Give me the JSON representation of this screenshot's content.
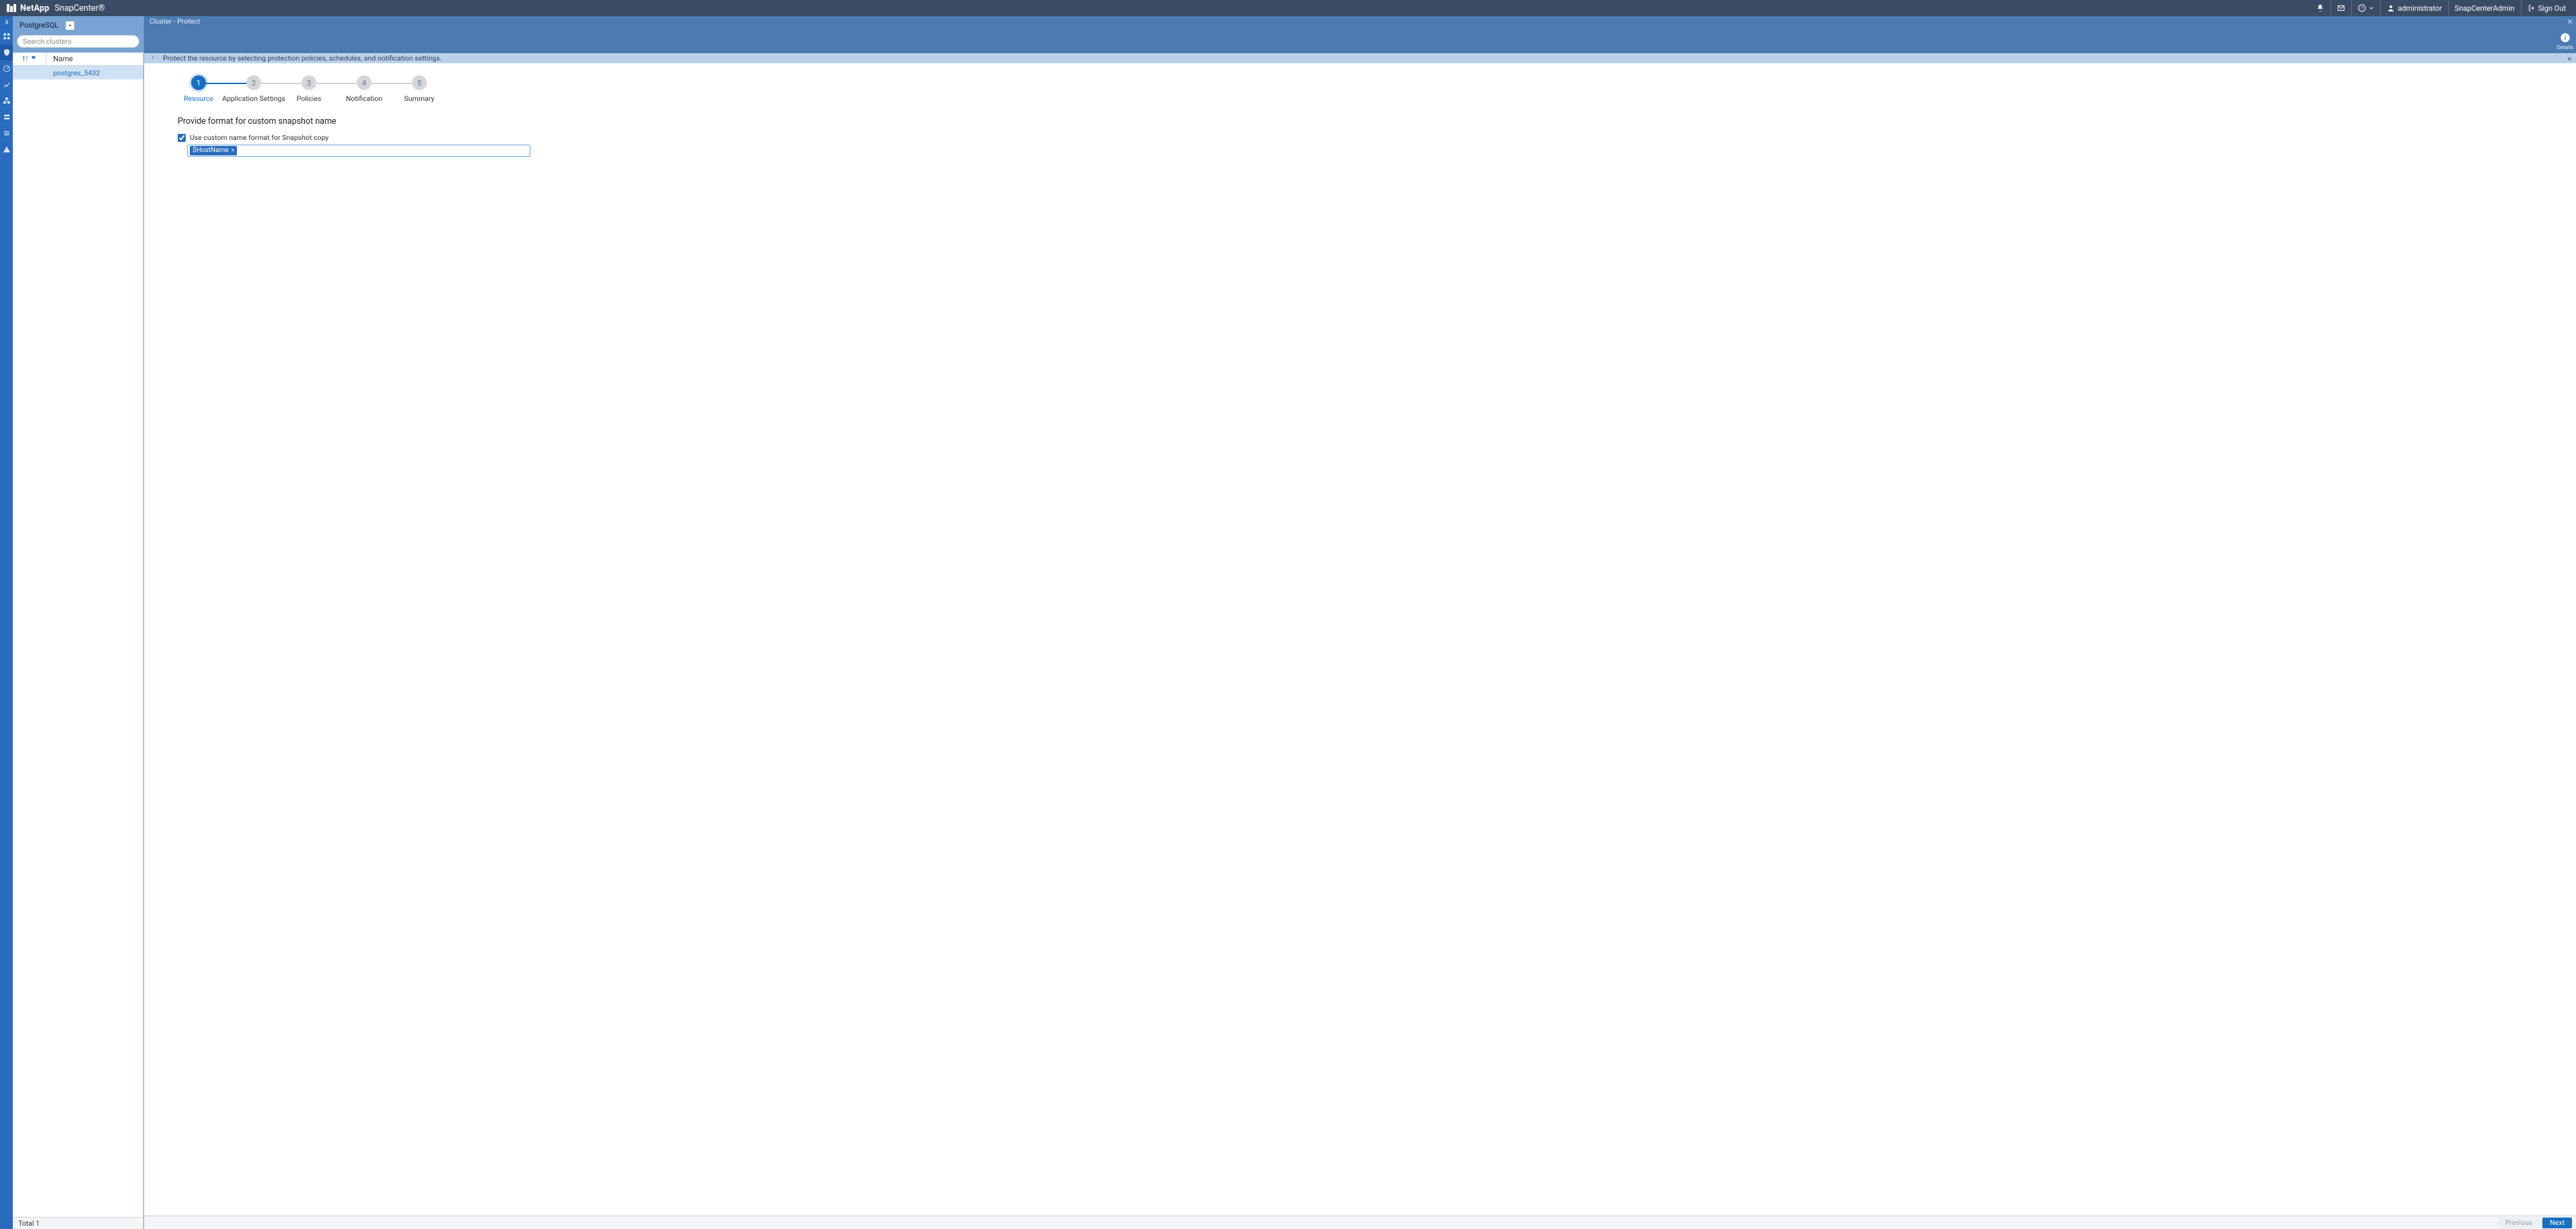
{
  "brand": {
    "vendor": "NetApp",
    "app": "SnapCenter®"
  },
  "topbar": {
    "user": "administrator",
    "role": "SnapCenterAdmin",
    "signout": "Sign Out"
  },
  "sidebar": {
    "plugin": "PostgreSQL",
    "search_placeholder": "Search clusters",
    "columns": {
      "name": "Name"
    },
    "rows": [
      "postgres_5432"
    ],
    "total_label": "Total 1"
  },
  "crumb": "Cluster - Protect",
  "band": {
    "details_label": "Details"
  },
  "hint": "Protect the resource by selecting protection policies, schedules, and notification settings.",
  "steps": [
    {
      "num": "1",
      "label": "Resource"
    },
    {
      "num": "2",
      "label": "Application Settings"
    },
    {
      "num": "3",
      "label": "Policies"
    },
    {
      "num": "4",
      "label": "Notification"
    },
    {
      "num": "5",
      "label": "Summary"
    }
  ],
  "form": {
    "heading": "Provide format for custom snapshot name",
    "checkbox_label": "Use custom name format for Snapshot copy",
    "checkbox_checked": true,
    "chips": [
      "$HostName"
    ]
  },
  "footer": {
    "prev": "Previous",
    "next": "Next"
  }
}
